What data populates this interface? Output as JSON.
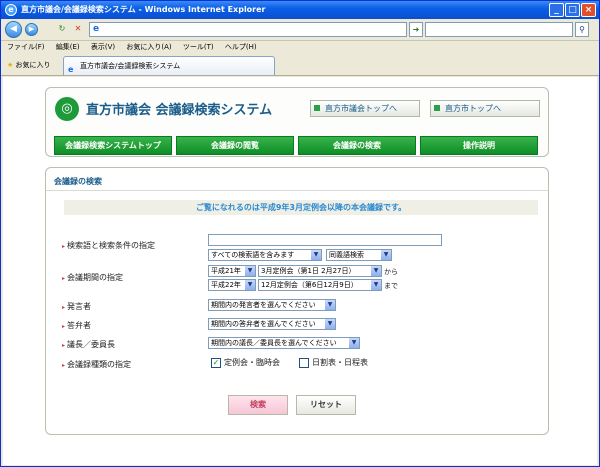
{
  "window": {
    "title": "直方市議会/会議録検索システム - Windows Internet Explorer"
  },
  "menu": [
    "ファイル(F)",
    "編集(E)",
    "表示(V)",
    "お気に入り(A)",
    "ツール(T)",
    "ヘルプ(H)"
  ],
  "favorites": {
    "label": "お気に入り",
    "tab_title": "直方市議会/会議録検索システム"
  },
  "header": {
    "site_title": "直方市議会 会議録検索システム",
    "links": [
      "直方市議会トップへ",
      "直方市トップへ"
    ],
    "nav": [
      "会議録検索システムトップ",
      "会議録の閲覧",
      "会議録の検索",
      "操作説明"
    ]
  },
  "main": {
    "section_title": "会議録の検索",
    "notice": "ご覧になれるのは平成9年3月定例会以降の本会議録です。",
    "fields": {
      "keyword_label": "検索語と検索条件の指定",
      "keyword_value": "",
      "cond1": "すべての検索語を含みます",
      "cond2": "同義語検索",
      "period_label": "会議期間の指定",
      "from_year": "平成21年",
      "from_session": "3月定例会（第1日 2月27日）",
      "from_suffix": "から",
      "to_year": "平成22年",
      "to_session": "12月定例会（第6日12月9日）",
      "to_suffix": "まで",
      "speaker_label": "発言者",
      "speaker_value": "期間内の発言者を選んでください",
      "answerer_label": "答弁者",
      "answerer_value": "期間内の答弁者を選んでください",
      "chair_label": "議長／委員長",
      "chair_value": "期間内の議長／委員長を選んでください",
      "type_label": "会議録種類の指定",
      "type1": "定例会・臨時会",
      "type1_checked": true,
      "type2": "日割表・日程表",
      "type2_checked": false
    },
    "buttons": {
      "search": "検索",
      "reset": "リセット"
    }
  }
}
